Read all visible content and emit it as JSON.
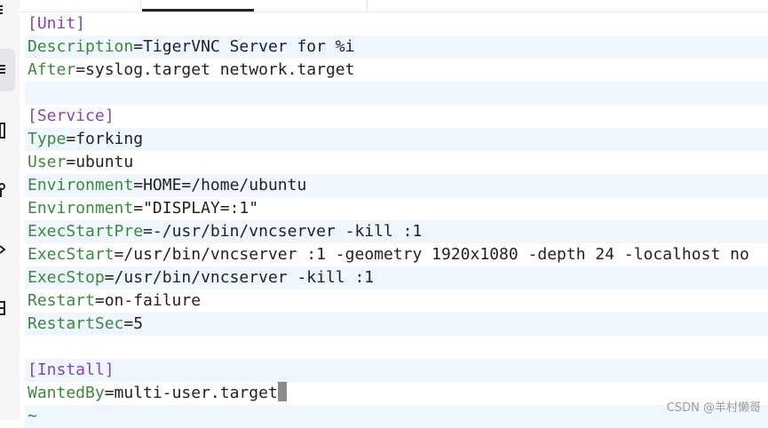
{
  "colors": {
    "key": "#3a8a3a",
    "section": "#8a3fc4",
    "text": "#222222",
    "row_alt": "#f0f6fd",
    "tilde": "#2a6fd6",
    "cursor": "#8b8b8b"
  },
  "gutter_icons": [
    "menu-icon",
    "file-icon",
    "key-icon",
    "arrow-icon",
    "terminal-icon"
  ],
  "editor": {
    "lines": [
      {
        "section": "[Unit]"
      },
      {
        "key": "Description",
        "eq": "=",
        "value": "TigerVNC Server for %i"
      },
      {
        "key": "After",
        "eq": "=",
        "value": "syslog.target network.target"
      },
      {
        "blank": ""
      },
      {
        "section": "[Service]"
      },
      {
        "key": "Type",
        "eq": "=",
        "value": "forking"
      },
      {
        "key": "User",
        "eq": "=",
        "value": "ubuntu"
      },
      {
        "key": "Environment",
        "eq": "=",
        "value": "HOME=/home/ubuntu"
      },
      {
        "key": "Environment",
        "eq": "=",
        "value": "\"DISPLAY=:1\""
      },
      {
        "key": "ExecStartPre",
        "eq": "=",
        "value": "-/usr/bin/vncserver -kill :1"
      },
      {
        "key": "ExecStart",
        "eq": "=",
        "value": "/usr/bin/vncserver :1 -geometry 1920x1080 -depth 24 -localhost no"
      },
      {
        "key": "ExecStop",
        "eq": "=",
        "value": "/usr/bin/vncserver -kill :1"
      },
      {
        "key": "Restart",
        "eq": "=",
        "value": "on-failure"
      },
      {
        "key": "RestartSec",
        "eq": "=",
        "value": "5"
      },
      {
        "blank": ""
      },
      {
        "section": "[Install]"
      },
      {
        "key": "WantedBy",
        "eq": "=",
        "value": "multi-user.target"
      },
      {
        "tilde": "~"
      }
    ]
  },
  "watermark": "CSDN @羊村懒哥"
}
